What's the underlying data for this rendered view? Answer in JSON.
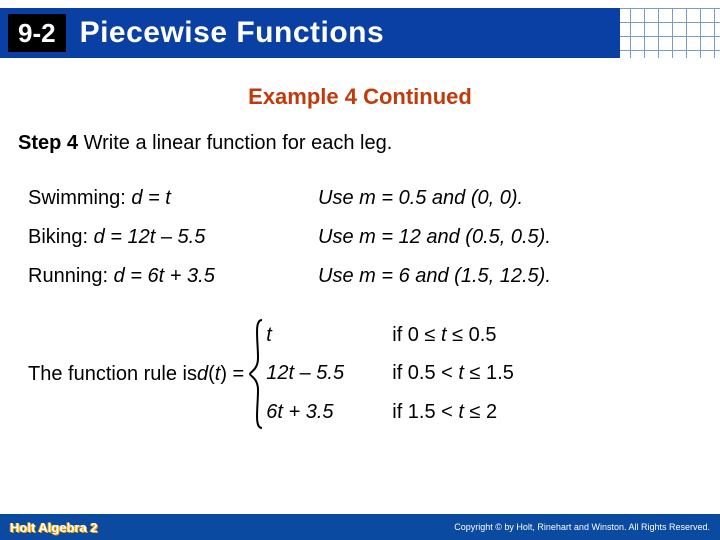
{
  "header": {
    "lesson_number": "9-2",
    "lesson_title": "Piecewise Functions"
  },
  "subtitle": "Example 4 Continued",
  "step": {
    "label": "Step 4",
    "text": " Write a linear function for each leg."
  },
  "legs": [
    {
      "name": "Swimming: ",
      "eq_lhs": "d",
      "eq_rhs": " = t",
      "hint_pre": "Use m = 0.5 and (0, 0)."
    },
    {
      "name": "Biking: ",
      "eq_lhs": "d",
      "eq_rhs": " = 12t – 5.5",
      "hint_pre": "Use m = 12 and (0.5, 0.5)."
    },
    {
      "name": "Running: ",
      "eq_lhs": "d",
      "eq_rhs": " = 6t + 3.5",
      "hint_pre": "Use m = 6 and (1.5, 12.5)."
    }
  ],
  "rule": {
    "prefix": "The function rule is ",
    "fn_var": "d",
    "fn_arg": "t",
    "pieces": [
      {
        "expr": "t",
        "cond_pre": "if 0 ≤ ",
        "cond_var": "t",
        "cond_post": " ≤ 0.5"
      },
      {
        "expr": "12t – 5.5",
        "cond_pre": "if 0.5 < ",
        "cond_var": "t",
        "cond_post": " ≤ 1.5"
      },
      {
        "expr": "6t + 3.5",
        "cond_pre": "if 1.5 < ",
        "cond_var": "t",
        "cond_post": " ≤ 2"
      }
    ]
  },
  "footer": {
    "book": "Holt Algebra 2",
    "copyright": "Copyright © by Holt, Rinehart and Winston. All Rights Reserved."
  }
}
